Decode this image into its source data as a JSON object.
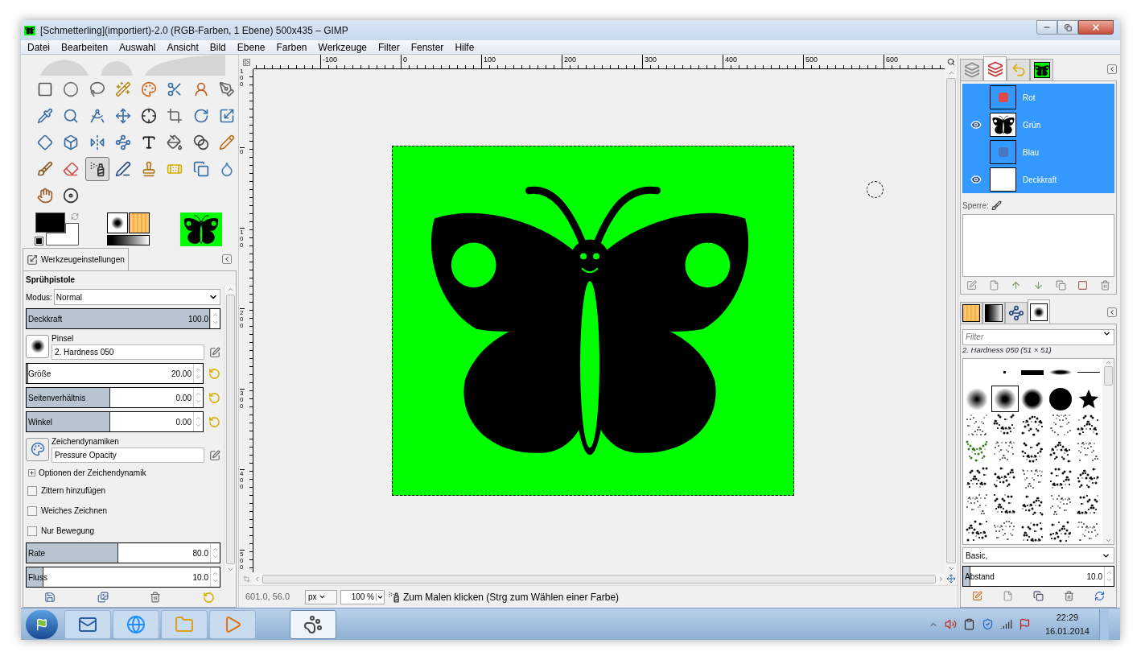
{
  "window": {
    "title": "[Schmetterling](importiert)-2.0 (RGB-Farben, 1 Ebene) 500x435 – GIMP"
  },
  "menu": [
    "Datei",
    "Bearbeiten",
    "Auswahl",
    "Ansicht",
    "Bild",
    "Ebene",
    "Farben",
    "Werkzeuge",
    "Filter",
    "Fenster",
    "Hilfe"
  ],
  "toolbox": {
    "tools": [
      {
        "selected": false
      },
      {
        "selected": false
      },
      {
        "selected": false
      },
      {
        "selected": false
      },
      {
        "selected": false
      },
      {
        "selected": false
      },
      {
        "selected": false
      },
      {
        "selected": false
      },
      {
        "selected": false
      },
      {
        "selected": false
      },
      {
        "selected": false
      },
      {
        "selected": false
      },
      {
        "selected": false
      },
      {
        "selected": false
      },
      {
        "selected": false
      },
      {
        "selected": false
      },
      {
        "selected": false
      },
      {
        "selected": false
      },
      {
        "selected": false
      },
      {
        "selected": false
      },
      {
        "selected": false
      },
      {
        "selected": false
      },
      {
        "selected": false
      },
      {
        "selected": false
      },
      {
        "selected": false
      },
      {
        "selected": false
      },
      {
        "selected": true
      },
      {
        "selected": false
      },
      {
        "selected": false
      },
      {
        "selected": false
      },
      {
        "selected": false
      },
      {
        "selected": false
      },
      {
        "selected": false
      },
      {
        "selected": false
      }
    ]
  },
  "tool_options": {
    "tab": "Werkzeugeinstellungen",
    "title": "Sprühpistole",
    "mode_label": "Modus:",
    "mode": "Normal",
    "opacity": {
      "label": "Deckkraft",
      "value": "100.0",
      "level": 1
    },
    "brush_label": "Pinsel",
    "brush": "2. Hardness 050",
    "size": {
      "label": "Größe",
      "value": "20.00",
      "level": 0.01
    },
    "aspect": {
      "label": "Seitenverhältnis",
      "value": "0.00",
      "level": 0.5
    },
    "angle": {
      "label": "Winkel",
      "value": "0.00",
      "level": 0.5
    },
    "dynamics_label": "Zeichendynamiken",
    "dynamics": "Pressure Opacity",
    "dynamics_options": {
      "label": "Optionen der Zeichendynamik",
      "expanded": false
    },
    "checkboxes": [
      {
        "label": "Zittern hinzufügen",
        "checked": false
      },
      {
        "label": "Weiches Zeichnen",
        "checked": false
      },
      {
        "label": "Nur Bewegung",
        "checked": false
      }
    ],
    "rate": {
      "label": "Rate",
      "value": "80.0",
      "level": 0.5
    },
    "flow": {
      "label": "Fluss",
      "value": "10.0",
      "level": 0.09
    }
  },
  "ruler_h": {
    "labels": [
      "-100",
      "0",
      "100",
      "200",
      "300",
      "400",
      "500",
      "600"
    ]
  },
  "ruler_v": {
    "labels": [
      "100",
      "0",
      "100",
      "200",
      "300",
      "400",
      "500"
    ]
  },
  "status_bar": {
    "coordinates": "601.0, 56.0",
    "unit": "px",
    "zoom": "100 %",
    "message": "Zum Malen klicken (Strg zum Wählen einer Farbe)"
  },
  "channels_dock": {
    "tabs": [
      {
        "selected": false
      },
      {
        "selected": true
      },
      {
        "selected": false
      },
      {
        "selected": false
      }
    ],
    "channels": [
      {
        "name": "Rot",
        "visible": false,
        "selected": true
      },
      {
        "name": "Grün",
        "visible": true,
        "selected": true
      },
      {
        "name": "Blau",
        "visible": false,
        "selected": true
      },
      {
        "name": "Deckkraft",
        "visible": true,
        "selected": true
      }
    ],
    "lock_label": "Sperre:"
  },
  "brushes_dock": {
    "tabs": [
      {
        "selected": false
      },
      {
        "selected": false
      },
      {
        "selected": false
      },
      {
        "selected": true
      }
    ],
    "filter_placeholder": "Filter",
    "brush_info": "2. Hardness 050 (51 × 51)",
    "brushes": [
      {
        "selected": false
      },
      {
        "selected": false
      },
      {
        "selected": false
      },
      {
        "selected": false
      },
      {
        "selected": false
      },
      {
        "selected": true
      },
      {
        "selected": false
      },
      {
        "selected": false
      },
      {
        "selected": false
      },
      {
        "selected": false
      },
      {
        "selected": false
      },
      {
        "selected": false
      },
      {
        "selected": false
      },
      {
        "selected": false
      },
      {
        "selected": false
      },
      {
        "selected": false
      },
      {
        "selected": false
      },
      {
        "selected": false
      },
      {
        "selected": false
      },
      {
        "selected": false
      },
      {
        "selected": false
      },
      {
        "selected": false
      },
      {
        "selected": false
      },
      {
        "selected": false
      },
      {
        "selected": false
      },
      {
        "selected": false
      },
      {
        "selected": false
      },
      {
        "selected": false
      },
      {
        "selected": false
      },
      {
        "selected": false
      },
      {
        "selected": false
      },
      {
        "selected": false
      },
      {
        "selected": false
      },
      {
        "selected": false
      }
    ],
    "tag": "Basic,",
    "spacing": {
      "label": "Abstand",
      "value": "10.0",
      "level": 0.05
    }
  },
  "taskbar": {
    "apps": [
      {
        "selected": false
      },
      {
        "selected": false
      },
      {
        "selected": false
      },
      {
        "selected": false
      },
      {
        "selected": true
      }
    ],
    "time": "22:29",
    "date": "16.01.2014"
  }
}
